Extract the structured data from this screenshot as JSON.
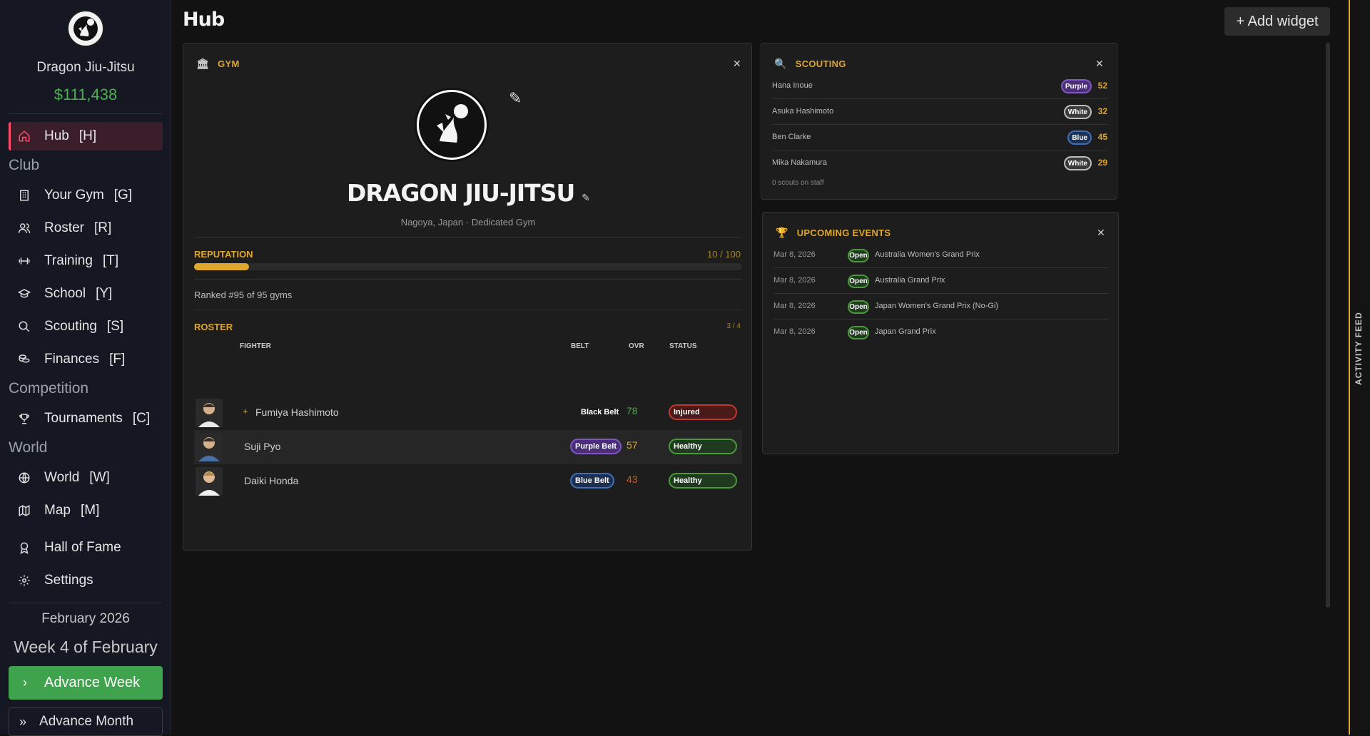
{
  "sidebar": {
    "gym_name": "Dragon Jiu-Jitsu",
    "money": "$111,438",
    "items": [
      {
        "label": "Hub",
        "key": "[H]"
      },
      {
        "label": "Your Gym",
        "key": "[G]"
      },
      {
        "label": "Roster",
        "key": "[R]"
      },
      {
        "label": "Training",
        "key": "[T]"
      },
      {
        "label": "School",
        "key": "[Y]"
      },
      {
        "label": "Scouting",
        "key": "[S]"
      },
      {
        "label": "Finances",
        "key": "[F]"
      },
      {
        "label": "Tournaments",
        "key": "[C]"
      },
      {
        "label": "World",
        "key": "[W]"
      },
      {
        "label": "Map",
        "key": "[M]"
      },
      {
        "label": "Hall of Fame"
      },
      {
        "label": "Settings"
      }
    ],
    "sections": {
      "club": "Club",
      "competition": "Competition",
      "world": "World"
    },
    "date": "February 2026",
    "week": "Week 4 of February",
    "advance_week": "Advance Week",
    "advance_month": "Advance Month"
  },
  "page": {
    "title": "Hub",
    "add_widget": "+ Add widget"
  },
  "gym": {
    "header": "GYM",
    "name": "DRAGON JIU-JITSU",
    "location": "Nagoya, Japan",
    "type": "Dedicated Gym",
    "reputation_label": "REPUTATION",
    "reputation_value": "10 / 100",
    "reputation_fraction": 0.1,
    "ranked": "Ranked #95 of 95 gyms",
    "roster_label": "ROSTER",
    "roster_count": "3 / 4",
    "columns": {
      "fighter": "FIGHTER",
      "belt": "BELT",
      "ovr": "OVR",
      "status": "STATUS"
    },
    "fighters": [
      {
        "name": "Fumiya Hashimoto",
        "belt": "Black Belt",
        "ovr": "78",
        "status": "Injured"
      },
      {
        "name": "Suji Pyo",
        "belt": "Purple Belt",
        "ovr": "57",
        "status": "Healthy"
      },
      {
        "name": "Daiki Honda",
        "belt": "Blue Belt",
        "ovr": "43",
        "status": "Healthy"
      }
    ]
  },
  "scouting": {
    "header": "SCOUTING",
    "rows": [
      {
        "name": "Hana Inoue",
        "belt": "Purple",
        "value": "52"
      },
      {
        "name": "Asuka Hashimoto",
        "belt": "White",
        "value": "32"
      },
      {
        "name": "Ben Clarke",
        "belt": "Blue",
        "value": "45"
      },
      {
        "name": "Mika Nakamura",
        "belt": "White",
        "value": "29"
      }
    ],
    "footer": "0 scouts on staff"
  },
  "events": {
    "header": "UPCOMING EVENTS",
    "rows": [
      {
        "date": "Mar 8, 2026",
        "status": "Open",
        "name": "Australia Women's Grand Prix"
      },
      {
        "date": "Mar 8, 2026",
        "status": "Open",
        "name": "Australia Grand Prix"
      },
      {
        "date": "Mar 8, 2026",
        "status": "Open",
        "name": "Japan Women's Grand Prix (No-Gi)"
      },
      {
        "date": "Mar 8, 2026",
        "status": "Open",
        "name": "Japan Grand Prix"
      }
    ]
  },
  "feed": {
    "label": "ACTIVITY FEED"
  },
  "colors": {
    "accent": "#e0a72d",
    "hub_active": "#ff4d6d",
    "money": "#4caf50",
    "advance": "#3fa34d"
  }
}
